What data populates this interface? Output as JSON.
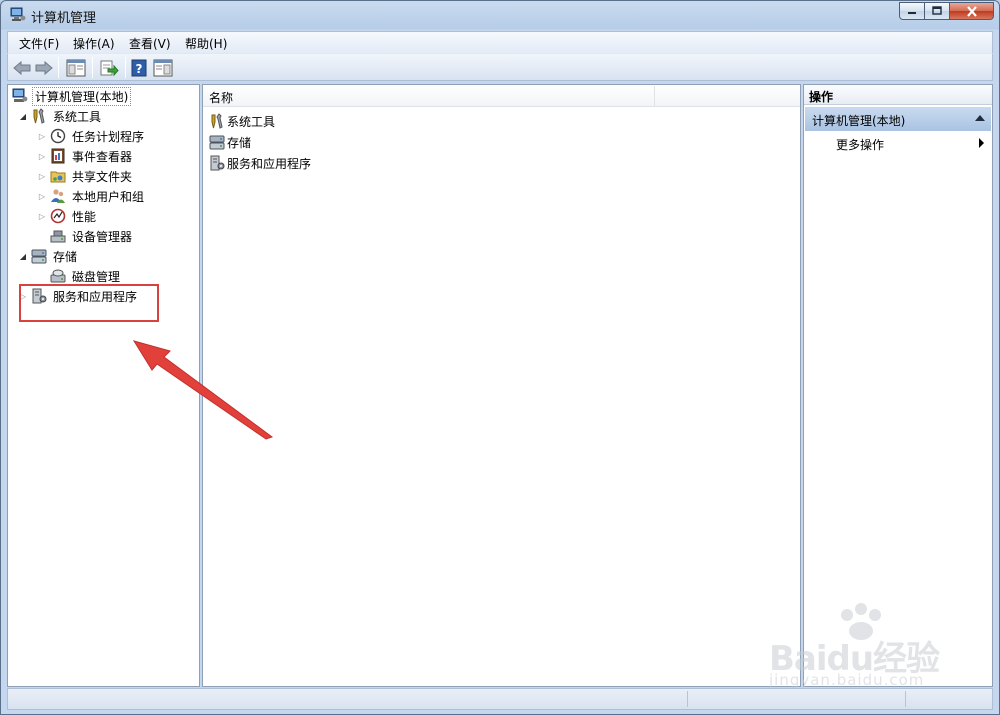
{
  "window": {
    "title": "计算机管理"
  },
  "menu": [
    "文件(F)",
    "操作(A)",
    "查看(V)",
    "帮助(H)"
  ],
  "toolbar": {
    "buttons": [
      "back-icon",
      "forward-icon",
      "show-hide-console-tree-icon",
      "export-list-icon",
      "help-icon",
      "show-hide-action-pane-icon"
    ]
  },
  "tree": {
    "root": "计算机管理(本地)",
    "system_tools": "系统工具",
    "task_scheduler": "任务计划程序",
    "event_viewer": "事件查看器",
    "shared_folders": "共享文件夹",
    "local_users": "本地用户和组",
    "performance": "性能",
    "device_manager": "设备管理器",
    "storage": "存储",
    "disk_management": "磁盘管理",
    "services_apps": "服务和应用程序"
  },
  "content": {
    "column_name": "名称",
    "items": [
      "系统工具",
      "存储",
      "服务和应用程序"
    ]
  },
  "actions": {
    "header": "操作",
    "section": "计算机管理(本地)",
    "more": "更多操作"
  },
  "watermark": {
    "logo": "Baidu经验",
    "sub": "jingyan.baidu.com"
  },
  "colors": {
    "highlight": "#d9413f",
    "selection_band": "#b5cbe6"
  }
}
